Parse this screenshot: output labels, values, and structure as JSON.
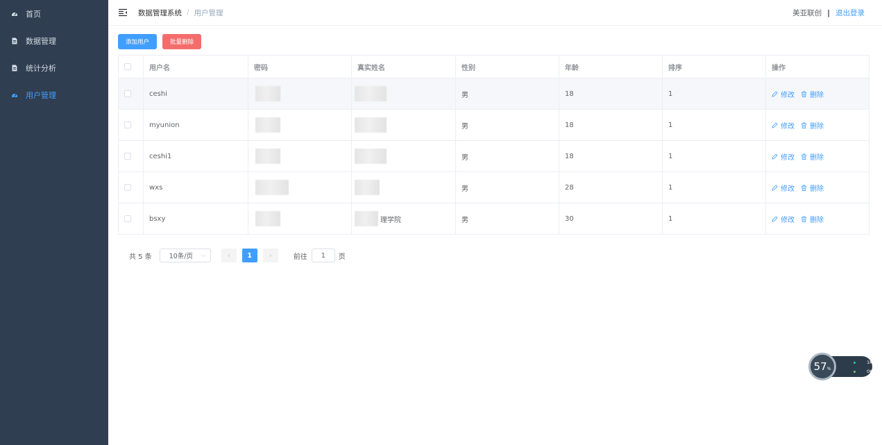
{
  "sidebar": {
    "items": [
      {
        "label": "首页",
        "icon": "dashboard-icon",
        "active": false
      },
      {
        "label": "数据管理",
        "icon": "document-icon",
        "active": false
      },
      {
        "label": "统计分析",
        "icon": "document-icon",
        "active": false
      },
      {
        "label": "用户管理",
        "icon": "dashboard-icon",
        "active": true
      }
    ]
  },
  "header": {
    "breadcrumb_root": "数据管理系统",
    "breadcrumb_sep": "/",
    "breadcrumb_current": "用户管理",
    "company": "美亚联创",
    "separator": "|",
    "logout": "退出登录"
  },
  "actions": {
    "add_label": "添加用户",
    "batch_delete_label": "批量删除"
  },
  "table": {
    "columns": [
      "用户名",
      "密码",
      "真实姓名",
      "性别",
      "年龄",
      "排序",
      "操作"
    ],
    "rows": [
      {
        "username": "ceshi",
        "realname_visible": "",
        "gender": "男",
        "age": "18",
        "sort": "1"
      },
      {
        "username": "myunion",
        "realname_visible": "",
        "gender": "男",
        "age": "18",
        "sort": "1"
      },
      {
        "username": "ceshi1",
        "realname_visible": "",
        "gender": "男",
        "age": "18",
        "sort": "1"
      },
      {
        "username": "wxs",
        "realname_visible": "",
        "gender": "男",
        "age": "28",
        "sort": "1"
      },
      {
        "username": "bsxy",
        "realname_visible": "理学院",
        "gender": "男",
        "age": "30",
        "sort": "1"
      }
    ],
    "edit_label": "修改",
    "delete_label": "删除"
  },
  "pagination": {
    "total": "共 5 条",
    "page_size": "10条/页",
    "prev": "‹",
    "current_page": "1",
    "next": "›",
    "goto_label": "前往",
    "goto_value": "1",
    "page_unit": "页"
  },
  "speed_widget": {
    "percent": "57",
    "percent_unit": "%",
    "upload": "1K/s",
    "download": "0K/s"
  },
  "colors": {
    "sidebar_bg": "#2f3e50",
    "primary": "#409eff",
    "danger": "#f56c6c"
  }
}
